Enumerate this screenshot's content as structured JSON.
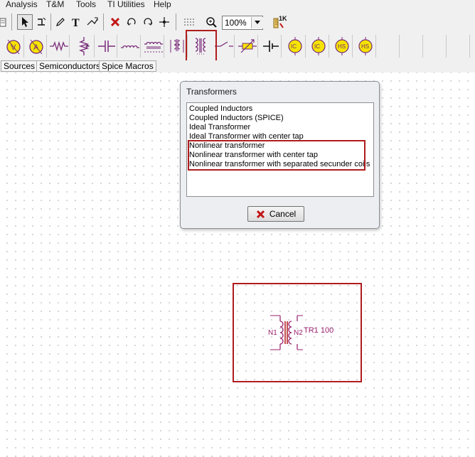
{
  "menu": [
    "Analysis",
    "T&M",
    "Tools",
    "TI Utilities",
    "Help"
  ],
  "toolbar": {
    "zoom_value": "100%",
    "tools": [
      "select-arrow",
      "wire",
      "pencil",
      "text",
      "drag",
      "delete",
      "undo",
      "redo",
      "node",
      "grid",
      "zoom",
      "zoom-dropdown",
      "ruler"
    ]
  },
  "component_bar": {
    "icons": [
      "voltmeter",
      "ammeter",
      "resistor",
      "potentiometer",
      "capacitor",
      "inductor",
      "coupled-inductor",
      "transformer-3d",
      "transformer",
      "switch",
      "varistor",
      "battery",
      "current-ic",
      "voltage-ic",
      "hs-source",
      "hs-pulse"
    ]
  },
  "tabs": [
    "Sources",
    "Semiconductors",
    "Spice Macros"
  ],
  "dialog": {
    "title": "Transformers",
    "items": [
      "Coupled Inductors",
      "Coupled Inductors (SPICE)",
      "Ideal Transformer",
      "Ideal Transformer with center tap",
      "Nonlinear transformer",
      "Nonlinear transformer with center tap",
      "Nonlinear transformer with separated secunder coils"
    ],
    "cancel_label": "Cancel"
  },
  "schematic": {
    "n1_label": "N1",
    "n2_label": "N2",
    "part_label": "TR1 100",
    "color": "#9a1f6e"
  },
  "colors": {
    "highlight": "#b01c1c",
    "component": "#9a1f6e"
  }
}
